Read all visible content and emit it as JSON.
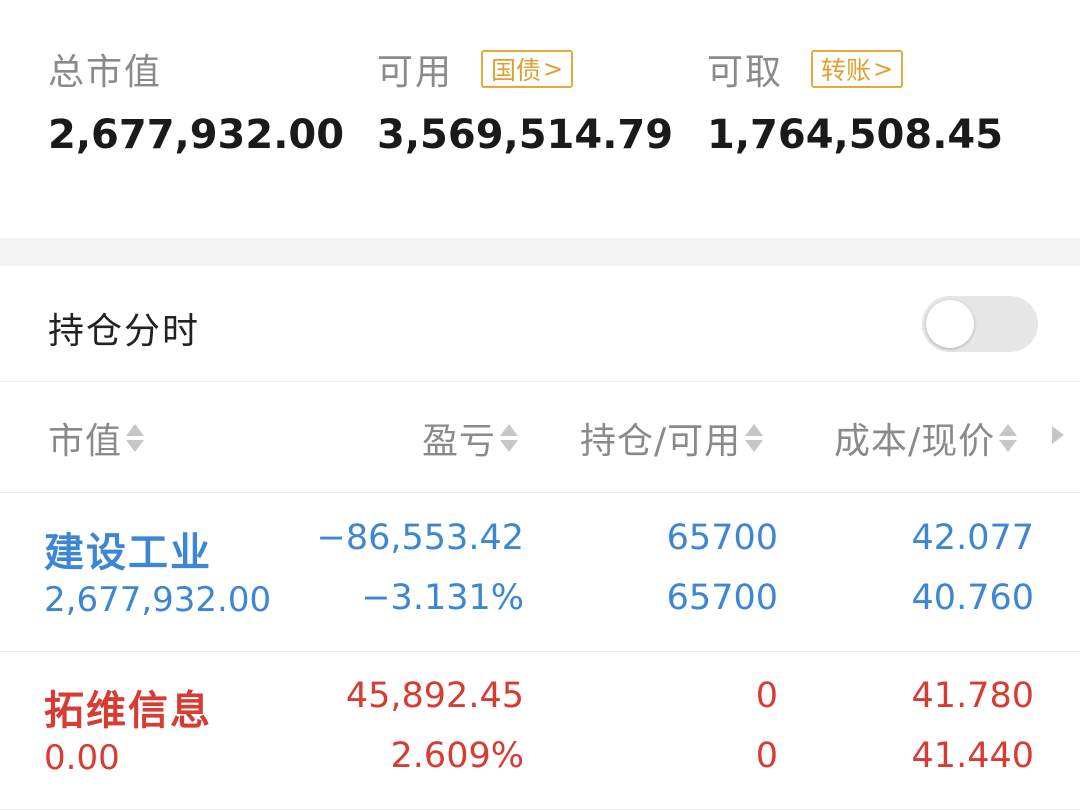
{
  "summary": {
    "total_market_value": {
      "label": "总市值",
      "value": "2,677,932.00"
    },
    "available": {
      "label": "可用",
      "tag": "国债",
      "value": "3,569,514.79"
    },
    "withdrawable": {
      "label": "可取",
      "tag": "转账",
      "value": "1,764,508.45"
    }
  },
  "timeshare": {
    "label": "持仓分时",
    "enabled": false
  },
  "table_header": {
    "market_value": "市值",
    "profit_loss": "盈亏",
    "position_available": "持仓/可用",
    "cost_price": "成本/现价"
  },
  "positions": [
    {
      "name": "建设工业",
      "market_value": "2,677,932.00",
      "profit_loss": "−86,553.42",
      "profit_loss_pct": "−3.131%",
      "position": "65700",
      "available": "65700",
      "cost": "42.077",
      "price": "40.760",
      "color": "#3d86d4"
    },
    {
      "name": "拓维信息",
      "market_value": "0.00",
      "profit_loss": "45,892.45",
      "profit_loss_pct": "2.609%",
      "position": "0",
      "available": "0",
      "cost": "41.780",
      "price": "41.440",
      "color": "#d83b32"
    }
  ],
  "colors": {
    "accent_tag": "#e8a93b",
    "loss": "#3d86d4",
    "gain": "#d83b32"
  }
}
